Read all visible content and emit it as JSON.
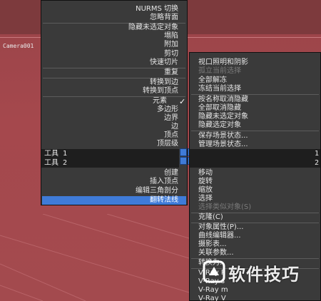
{
  "viewport": {
    "label": "Camera001"
  },
  "left_menu": {
    "items": [
      {
        "label": "NURMS 切换",
        "state": "normal"
      },
      {
        "label": "忽略背面",
        "state": "normal"
      },
      {
        "label": "隐藏未选定对象",
        "state": "normal"
      },
      {
        "label": "塌陷",
        "state": "normal"
      },
      {
        "label": "附加",
        "state": "normal"
      },
      {
        "label": "剪切",
        "state": "normal"
      },
      {
        "label": "快速切片",
        "state": "normal"
      },
      {
        "label": "重复",
        "state": "normal"
      },
      {
        "label": "转换到边",
        "state": "normal"
      },
      {
        "label": "转换到顶点",
        "state": "normal"
      },
      {
        "label": "元素",
        "state": "checked"
      },
      {
        "label": "多边形",
        "state": "normal"
      },
      {
        "label": "边界",
        "state": "normal"
      },
      {
        "label": "边",
        "state": "normal"
      },
      {
        "label": "顶点",
        "state": "normal"
      },
      {
        "label": "顶层级",
        "state": "normal"
      },
      {
        "label": "创建",
        "state": "normal"
      },
      {
        "label": "插入顶点",
        "state": "normal"
      },
      {
        "label": "编辑三角剖分",
        "state": "normal"
      },
      {
        "label": "翻转法线",
        "state": "highlight"
      }
    ],
    "quad_labels": [
      "工具 1",
      "工具 2"
    ]
  },
  "right_menu": {
    "items": [
      {
        "label": "视口照明和阴影",
        "state": "normal"
      },
      {
        "label": "孤立当前选择",
        "state": "disabled"
      },
      {
        "label": "全部解冻",
        "state": "normal"
      },
      {
        "label": "冻结当前选择",
        "state": "normal"
      },
      {
        "label": "按名称取消隐藏",
        "state": "normal"
      },
      {
        "label": "全部取消隐藏",
        "state": "normal"
      },
      {
        "label": "隐藏未选定对象",
        "state": "normal"
      },
      {
        "label": "隐藏选定对象",
        "state": "normal"
      },
      {
        "label": "保存场景状态...",
        "state": "normal"
      },
      {
        "label": "管理场景状态...",
        "state": "normal"
      },
      {
        "label": "移动",
        "state": "normal"
      },
      {
        "label": "旋转",
        "state": "normal"
      },
      {
        "label": "缩放",
        "state": "normal"
      },
      {
        "label": "选择",
        "state": "normal"
      },
      {
        "label": "选择类似对象(S)",
        "state": "disabled"
      },
      {
        "label": "克隆(C)",
        "state": "normal"
      },
      {
        "label": "对象属性(P)...",
        "state": "normal"
      },
      {
        "label": "曲线编辑器...",
        "state": "normal"
      },
      {
        "label": "摄影表...",
        "state": "normal"
      },
      {
        "label": "关联参数...",
        "state": "normal"
      },
      {
        "label": "转换为:",
        "state": "normal"
      },
      {
        "label": "V-Ray P",
        "state": "normal"
      },
      {
        "label": "V-Ray s",
        "state": "normal"
      },
      {
        "label": "V-Ray m",
        "state": "normal"
      },
      {
        "label": "V-Ray V",
        "state": "normal"
      }
    ],
    "quad_labels": [
      "1",
      "2"
    ]
  },
  "check_glyph": "✓",
  "watermark": {
    "text": "软件技巧"
  },
  "colors": {
    "highlight": "#3f7bd8",
    "menu_bg": "#3a3a3a",
    "viewport_bg": "#a8464b"
  }
}
